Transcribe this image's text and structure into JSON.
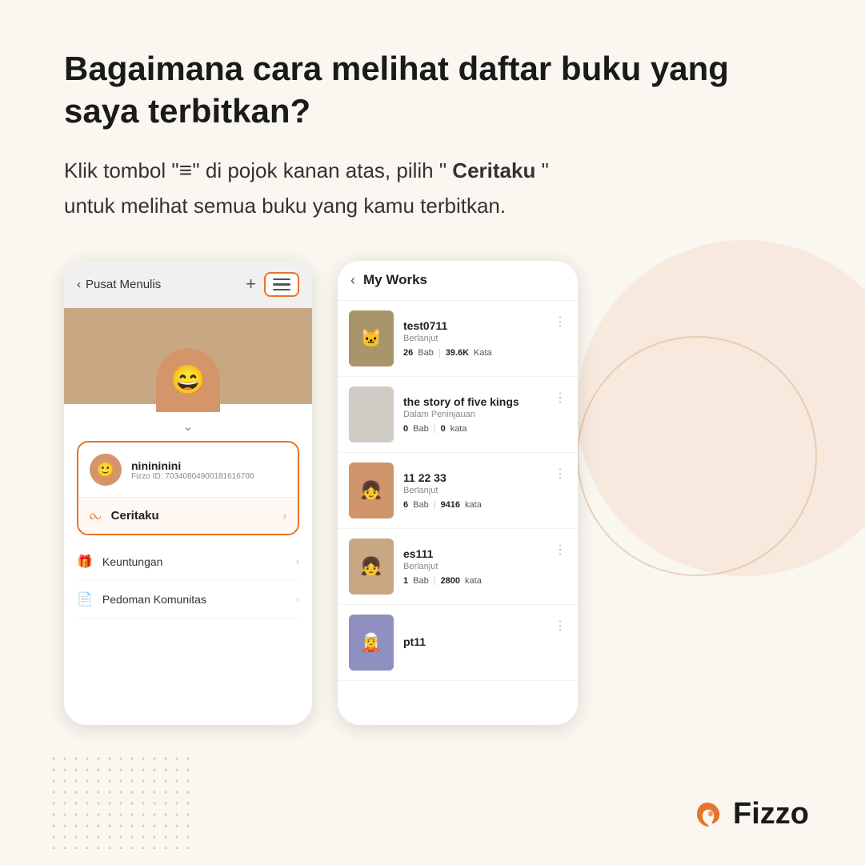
{
  "page": {
    "bg_color": "#faf6f0",
    "title": "Bagaimana cara melihat daftar buku yang saya terbitkan?",
    "subtitle_part1": "Klik tombol \"",
    "subtitle_menu_icon": "≡",
    "subtitle_part2": "\" di pojok kanan atas, pilih \"",
    "subtitle_bold": " Ceritaku ",
    "subtitle_part3": "\"",
    "subtitle_part4": " untuk melihat semua buku yang kamu terbitkan."
  },
  "left_phone": {
    "header_back": "Pusat Menulis",
    "header_plus": "+",
    "user_name": "ninininini",
    "user_fid": "Fizzo ID: 70340804900181616700",
    "menu_ceritaku_label": "Ceritaku",
    "menu_other_items": [
      {
        "label": "Keuntungan",
        "icon": "🎁"
      },
      {
        "label": "Pedoman Komunitas",
        "icon": "📄"
      }
    ]
  },
  "right_phone": {
    "header_back": "<",
    "header_title": "My Works",
    "works": [
      {
        "title": "test0711",
        "status": "Berlanjut",
        "bab": "26",
        "kata": "39.6K",
        "bab_label": "Bab",
        "kata_label": "Kata",
        "thumb_class": "work-thumb-1",
        "emoji": "🐱"
      },
      {
        "title": "the story of five kings",
        "status": "Dalam Peninjauan",
        "bab": "0",
        "kata": "0",
        "bab_label": "Bab",
        "kata_label": "kata",
        "thumb_class": "work-thumb-2",
        "emoji": ""
      },
      {
        "title": "11 22 33",
        "status": "Berlanjut",
        "bab": "6",
        "kata": "9416",
        "bab_label": "Bab",
        "kata_label": "kata",
        "thumb_class": "work-thumb-3",
        "emoji": "👧"
      },
      {
        "title": "es111",
        "status": "Berlanjut",
        "bab": "1",
        "kata": "2800",
        "bab_label": "Bab",
        "kata_label": "kata",
        "thumb_class": "work-thumb-4",
        "emoji": "👧"
      },
      {
        "title": "pt11",
        "status": "",
        "bab": "",
        "kata": "",
        "bab_label": "",
        "kata_label": "",
        "thumb_class": "work-thumb-5",
        "emoji": "🧝"
      }
    ]
  },
  "brand": {
    "name": "Fizzo",
    "icon_color": "#e8732a"
  }
}
